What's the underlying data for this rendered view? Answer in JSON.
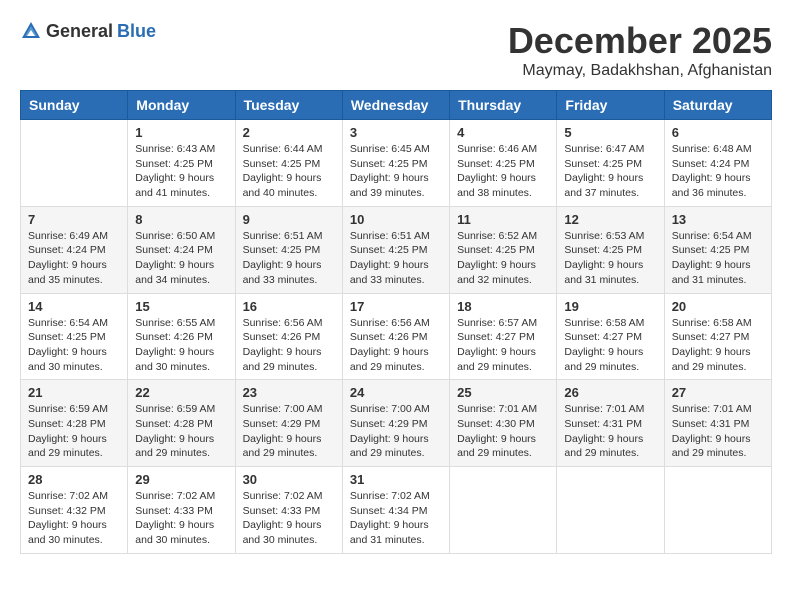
{
  "logo": {
    "general": "General",
    "blue": "Blue"
  },
  "header": {
    "month": "December 2025",
    "location": "Maymay, Badakhshan, Afghanistan"
  },
  "weekdays": [
    "Sunday",
    "Monday",
    "Tuesday",
    "Wednesday",
    "Thursday",
    "Friday",
    "Saturday"
  ],
  "weeks": [
    [
      {
        "day": "",
        "sunrise": "",
        "sunset": "",
        "daylight": ""
      },
      {
        "day": "1",
        "sunrise": "Sunrise: 6:43 AM",
        "sunset": "Sunset: 4:25 PM",
        "daylight": "Daylight: 9 hours and 41 minutes."
      },
      {
        "day": "2",
        "sunrise": "Sunrise: 6:44 AM",
        "sunset": "Sunset: 4:25 PM",
        "daylight": "Daylight: 9 hours and 40 minutes."
      },
      {
        "day": "3",
        "sunrise": "Sunrise: 6:45 AM",
        "sunset": "Sunset: 4:25 PM",
        "daylight": "Daylight: 9 hours and 39 minutes."
      },
      {
        "day": "4",
        "sunrise": "Sunrise: 6:46 AM",
        "sunset": "Sunset: 4:25 PM",
        "daylight": "Daylight: 9 hours and 38 minutes."
      },
      {
        "day": "5",
        "sunrise": "Sunrise: 6:47 AM",
        "sunset": "Sunset: 4:25 PM",
        "daylight": "Daylight: 9 hours and 37 minutes."
      },
      {
        "day": "6",
        "sunrise": "Sunrise: 6:48 AM",
        "sunset": "Sunset: 4:24 PM",
        "daylight": "Daylight: 9 hours and 36 minutes."
      }
    ],
    [
      {
        "day": "7",
        "sunrise": "Sunrise: 6:49 AM",
        "sunset": "Sunset: 4:24 PM",
        "daylight": "Daylight: 9 hours and 35 minutes."
      },
      {
        "day": "8",
        "sunrise": "Sunrise: 6:50 AM",
        "sunset": "Sunset: 4:24 PM",
        "daylight": "Daylight: 9 hours and 34 minutes."
      },
      {
        "day": "9",
        "sunrise": "Sunrise: 6:51 AM",
        "sunset": "Sunset: 4:25 PM",
        "daylight": "Daylight: 9 hours and 33 minutes."
      },
      {
        "day": "10",
        "sunrise": "Sunrise: 6:51 AM",
        "sunset": "Sunset: 4:25 PM",
        "daylight": "Daylight: 9 hours and 33 minutes."
      },
      {
        "day": "11",
        "sunrise": "Sunrise: 6:52 AM",
        "sunset": "Sunset: 4:25 PM",
        "daylight": "Daylight: 9 hours and 32 minutes."
      },
      {
        "day": "12",
        "sunrise": "Sunrise: 6:53 AM",
        "sunset": "Sunset: 4:25 PM",
        "daylight": "Daylight: 9 hours and 31 minutes."
      },
      {
        "day": "13",
        "sunrise": "Sunrise: 6:54 AM",
        "sunset": "Sunset: 4:25 PM",
        "daylight": "Daylight: 9 hours and 31 minutes."
      }
    ],
    [
      {
        "day": "14",
        "sunrise": "Sunrise: 6:54 AM",
        "sunset": "Sunset: 4:25 PM",
        "daylight": "Daylight: 9 hours and 30 minutes."
      },
      {
        "day": "15",
        "sunrise": "Sunrise: 6:55 AM",
        "sunset": "Sunset: 4:26 PM",
        "daylight": "Daylight: 9 hours and 30 minutes."
      },
      {
        "day": "16",
        "sunrise": "Sunrise: 6:56 AM",
        "sunset": "Sunset: 4:26 PM",
        "daylight": "Daylight: 9 hours and 29 minutes."
      },
      {
        "day": "17",
        "sunrise": "Sunrise: 6:56 AM",
        "sunset": "Sunset: 4:26 PM",
        "daylight": "Daylight: 9 hours and 29 minutes."
      },
      {
        "day": "18",
        "sunrise": "Sunrise: 6:57 AM",
        "sunset": "Sunset: 4:27 PM",
        "daylight": "Daylight: 9 hours and 29 minutes."
      },
      {
        "day": "19",
        "sunrise": "Sunrise: 6:58 AM",
        "sunset": "Sunset: 4:27 PM",
        "daylight": "Daylight: 9 hours and 29 minutes."
      },
      {
        "day": "20",
        "sunrise": "Sunrise: 6:58 AM",
        "sunset": "Sunset: 4:27 PM",
        "daylight": "Daylight: 9 hours and 29 minutes."
      }
    ],
    [
      {
        "day": "21",
        "sunrise": "Sunrise: 6:59 AM",
        "sunset": "Sunset: 4:28 PM",
        "daylight": "Daylight: 9 hours and 29 minutes."
      },
      {
        "day": "22",
        "sunrise": "Sunrise: 6:59 AM",
        "sunset": "Sunset: 4:28 PM",
        "daylight": "Daylight: 9 hours and 29 minutes."
      },
      {
        "day": "23",
        "sunrise": "Sunrise: 7:00 AM",
        "sunset": "Sunset: 4:29 PM",
        "daylight": "Daylight: 9 hours and 29 minutes."
      },
      {
        "day": "24",
        "sunrise": "Sunrise: 7:00 AM",
        "sunset": "Sunset: 4:29 PM",
        "daylight": "Daylight: 9 hours and 29 minutes."
      },
      {
        "day": "25",
        "sunrise": "Sunrise: 7:01 AM",
        "sunset": "Sunset: 4:30 PM",
        "daylight": "Daylight: 9 hours and 29 minutes."
      },
      {
        "day": "26",
        "sunrise": "Sunrise: 7:01 AM",
        "sunset": "Sunset: 4:31 PM",
        "daylight": "Daylight: 9 hours and 29 minutes."
      },
      {
        "day": "27",
        "sunrise": "Sunrise: 7:01 AM",
        "sunset": "Sunset: 4:31 PM",
        "daylight": "Daylight: 9 hours and 29 minutes."
      }
    ],
    [
      {
        "day": "28",
        "sunrise": "Sunrise: 7:02 AM",
        "sunset": "Sunset: 4:32 PM",
        "daylight": "Daylight: 9 hours and 30 minutes."
      },
      {
        "day": "29",
        "sunrise": "Sunrise: 7:02 AM",
        "sunset": "Sunset: 4:33 PM",
        "daylight": "Daylight: 9 hours and 30 minutes."
      },
      {
        "day": "30",
        "sunrise": "Sunrise: 7:02 AM",
        "sunset": "Sunset: 4:33 PM",
        "daylight": "Daylight: 9 hours and 30 minutes."
      },
      {
        "day": "31",
        "sunrise": "Sunrise: 7:02 AM",
        "sunset": "Sunset: 4:34 PM",
        "daylight": "Daylight: 9 hours and 31 minutes."
      },
      {
        "day": "",
        "sunrise": "",
        "sunset": "",
        "daylight": ""
      },
      {
        "day": "",
        "sunrise": "",
        "sunset": "",
        "daylight": ""
      },
      {
        "day": "",
        "sunrise": "",
        "sunset": "",
        "daylight": ""
      }
    ]
  ]
}
